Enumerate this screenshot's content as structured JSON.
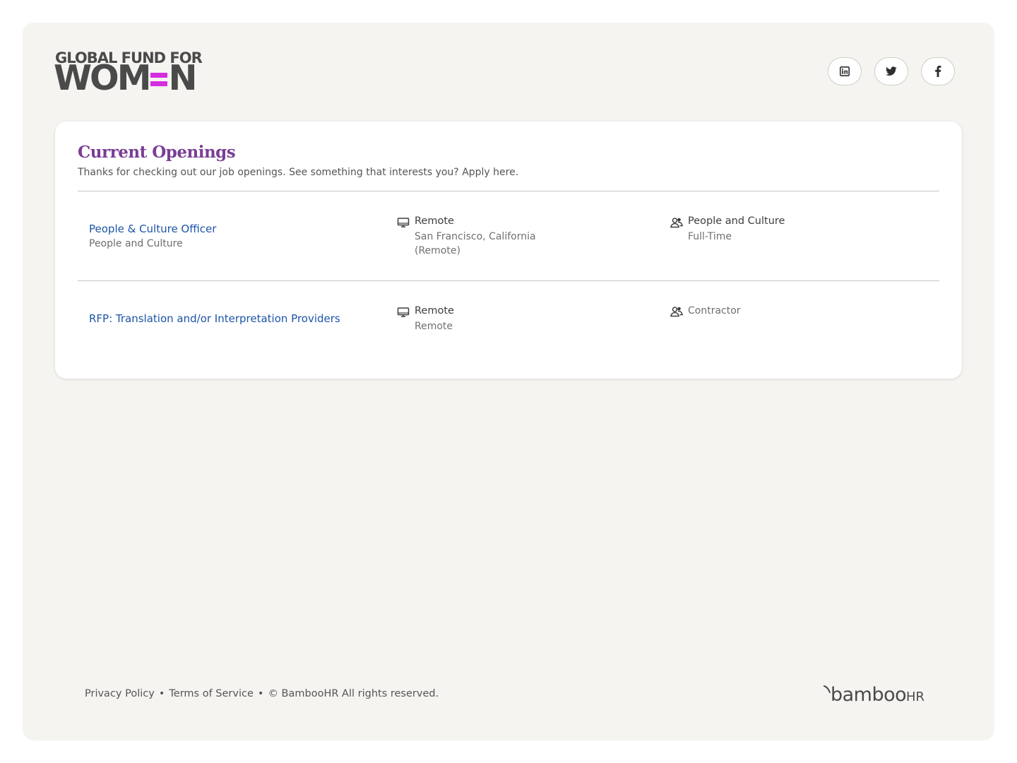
{
  "brand": {
    "logo_line1": "GLOBAL FUND FOR",
    "logo_line2_a": "WOM",
    "logo_line2_b": "N",
    "logo_accent_color": "#d42ee0"
  },
  "social": [
    {
      "name": "linkedin",
      "icon": "linkedin-icon"
    },
    {
      "name": "twitter",
      "icon": "twitter-icon"
    },
    {
      "name": "facebook",
      "icon": "facebook-icon"
    }
  ],
  "openings": {
    "title": "Current Openings",
    "subtitle": "Thanks for checking out our job openings. See something that interests you? Apply here.",
    "jobs": [
      {
        "title": "People & Culture Officer",
        "department": "People and Culture",
        "location_type": "Remote",
        "location": "San Francisco, California (Remote)",
        "team": "People and Culture",
        "employment_type": "Full-Time"
      },
      {
        "title": "RFP: Translation and/or Interpretation Providers",
        "department": "",
        "location_type": "Remote",
        "location": "Remote",
        "team": "Contractor",
        "employment_type": ""
      }
    ]
  },
  "footer": {
    "privacy": "Privacy Policy",
    "terms": "Terms of Service",
    "copyright": "© BambooHR All rights reserved.",
    "bamboo_a": "bamboo",
    "bamboo_b": "HR"
  },
  "colors": {
    "title_purple": "#7a3e95",
    "link_blue": "#1c54a8",
    "page_bg": "#f5f4f1"
  }
}
